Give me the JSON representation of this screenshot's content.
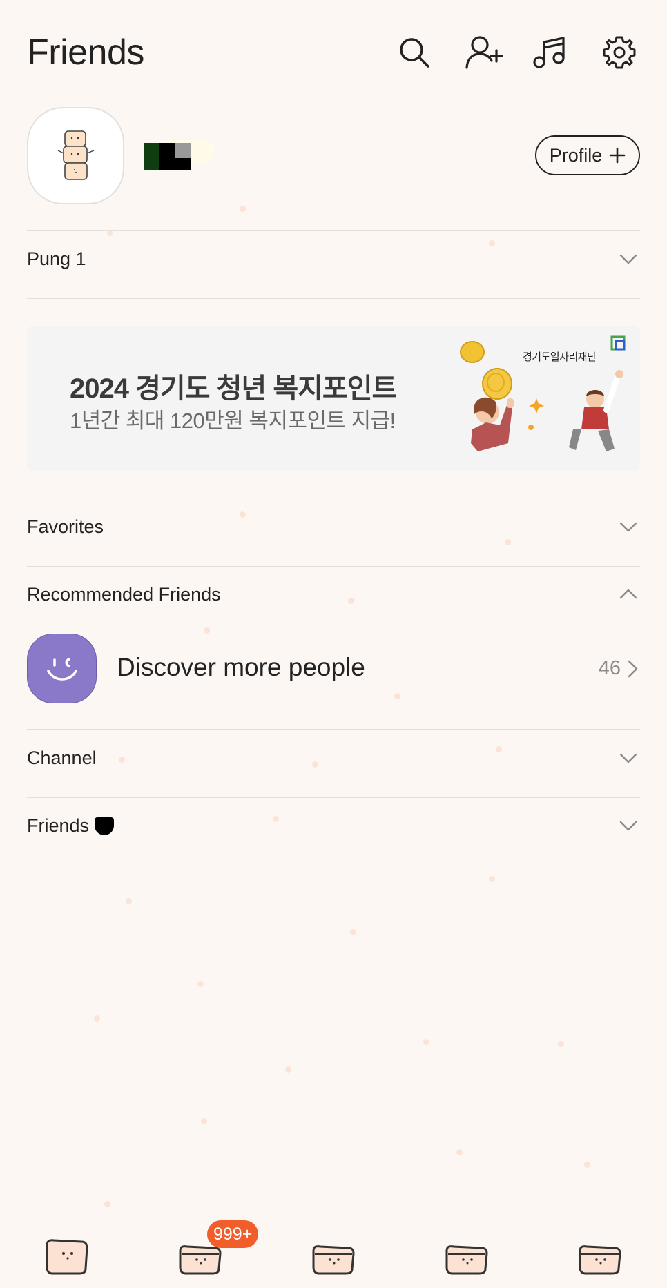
{
  "header": {
    "title": "Friends",
    "icons": [
      "search-icon",
      "add-friend-icon",
      "music-icon",
      "settings-icon"
    ]
  },
  "profile": {
    "button_label": "Profile"
  },
  "sections": {
    "pung": "Pung 1",
    "favorites": "Favorites",
    "recommended": "Recommended Friends",
    "channel": "Channel",
    "friends": "Friends"
  },
  "banner": {
    "title": "2024 경기도 청년 복지포인트",
    "subtitle": "1년간 최대 120만원 복지포인트 지급!",
    "org": "경기도일자리재단"
  },
  "recommended": {
    "title": "Discover more people",
    "count": "46"
  },
  "tabbar": {
    "badge": "999+",
    "tabs": [
      "tab-friends",
      "tab-chats",
      "tab-openchat",
      "tab-shopping",
      "tab-more"
    ]
  },
  "colors": {
    "background": "#fdf7f3",
    "badge": "#f25d2c",
    "reco_avatar": "#8a78c8",
    "banner_bg": "#f4f4f4"
  }
}
